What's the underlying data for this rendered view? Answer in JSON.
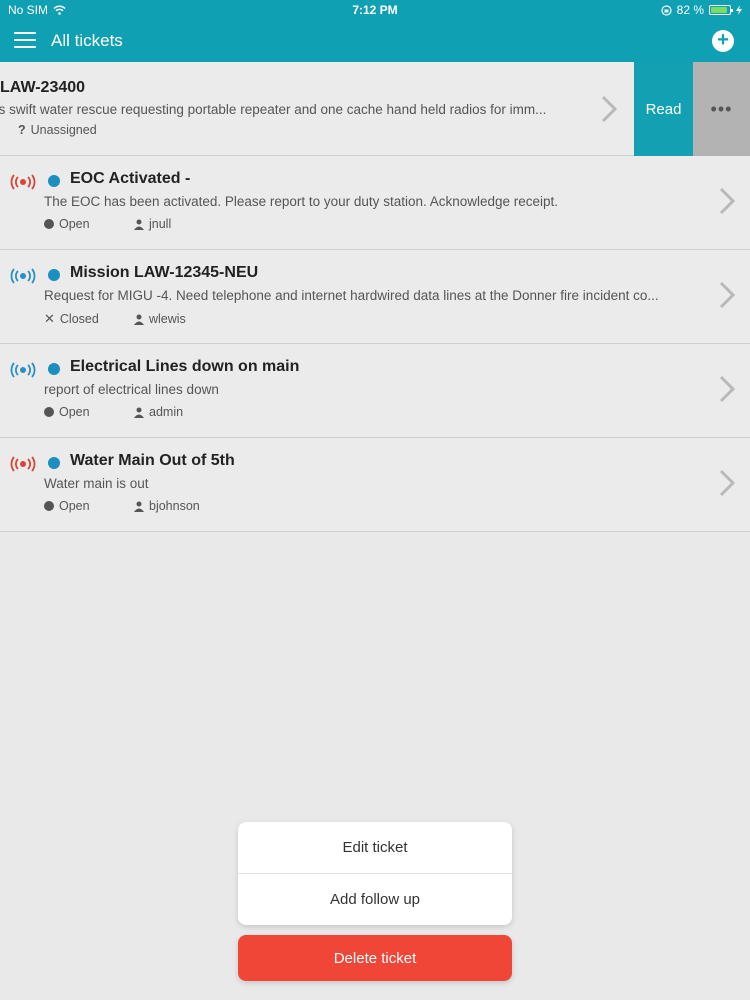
{
  "status_bar": {
    "carrier": "No SIM",
    "time": "7:12 PM",
    "battery": "82 %",
    "battery_level": 0.82
  },
  "header": {
    "title": "All tickets",
    "menu_icon": "hamburger-icon",
    "add_icon": "plus-circle-icon"
  },
  "swiped_ticket": {
    "title": "LAW-23400",
    "description": "'s swift water rescue requesting portable repeater and one cache hand held radios for imm...",
    "assignee": "Unassigned",
    "read_label": "Read",
    "more_label": "•••"
  },
  "tickets": [
    {
      "title": "EOC Activated -",
      "description": "The EOC has been activated. Please report to your duty station. Acknowledge receipt.",
      "status": "Open",
      "assignee": "jnull",
      "signal_color": "#d94436"
    },
    {
      "title": "Mission LAW-12345-NEU",
      "description": "Request for MIGU -4. Need telephone and internet hardwired data lines at the Donner fire incident co...",
      "status": "Closed",
      "assignee": "wlewis",
      "signal_color": "#2a8fc4"
    },
    {
      "title": "Electrical Lines down on main",
      "description": "report of electrical lines down",
      "status": "Open",
      "assignee": "admin",
      "signal_color": "#2a8fc4"
    },
    {
      "title": "Water Main Out of 5th",
      "description": "Water main is out",
      "status": "Open",
      "assignee": "bjohnson",
      "signal_color": "#d94436"
    }
  ],
  "action_sheet": {
    "edit": "Edit ticket",
    "follow_up": "Add follow up",
    "delete": "Delete ticket"
  },
  "colors": {
    "accent": "#0fa0b3",
    "delete": "#ef4638",
    "unread_dot": "#1a8fc0"
  }
}
